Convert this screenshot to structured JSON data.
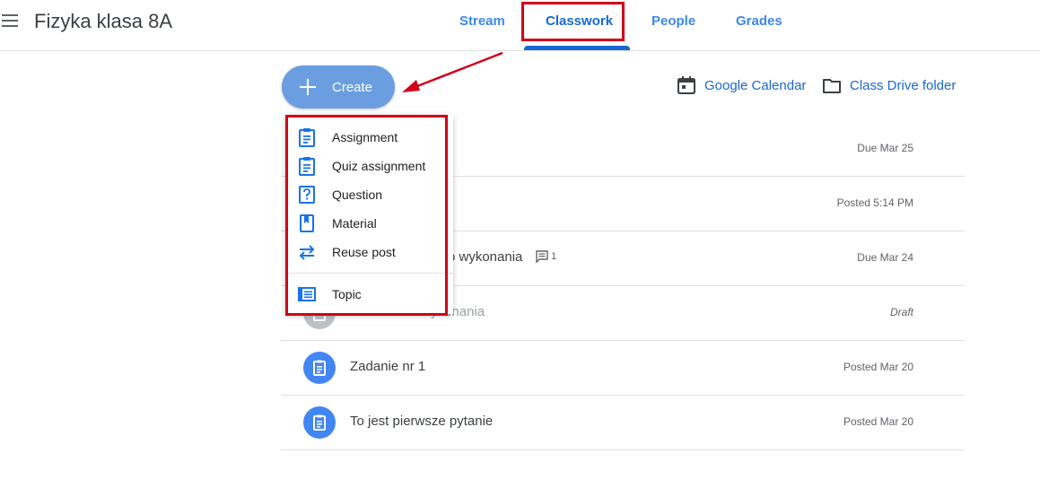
{
  "header": {
    "title": "Fizyka klasa 8A",
    "tabs": [
      {
        "label": "Stream"
      },
      {
        "label": "Classwork"
      },
      {
        "label": "People"
      },
      {
        "label": "Grades"
      }
    ],
    "active_tab": "Classwork"
  },
  "toolbar": {
    "create_label": "Create",
    "calendar_label": "Google Calendar",
    "drive_label": "Class Drive folder"
  },
  "create_menu": {
    "items": [
      {
        "label": "Assignment",
        "icon": "assignment-icon"
      },
      {
        "label": "Quiz assignment",
        "icon": "quiz-assignment-icon"
      },
      {
        "label": "Question",
        "icon": "question-icon"
      },
      {
        "label": "Material",
        "icon": "material-icon"
      },
      {
        "label": "Reuse post",
        "icon": "reuse-post-icon"
      }
    ],
    "topic": {
      "label": "Topic",
      "icon": "topic-icon"
    }
  },
  "classwork": {
    "rows": [
      {
        "title": "",
        "meta": "Due Mar 25"
      },
      {
        "title": "",
        "meta": "Posted 5:14 PM"
      },
      {
        "title": "o wykonania",
        "comments": "1",
        "meta": "Due Mar 24"
      },
      {
        "title": "Zadanie do wykonania",
        "meta": "Draft"
      },
      {
        "title": "Zadanie nr 1",
        "meta": "Posted Mar 20"
      },
      {
        "title": "To jest pierwsze pytanie",
        "meta": "Posted Mar 20"
      }
    ]
  },
  "colors": {
    "accent": "#1967d2",
    "create_button": "#6b9ee0",
    "highlight": "#d0021b",
    "icon_blue": "#1a73e8"
  }
}
